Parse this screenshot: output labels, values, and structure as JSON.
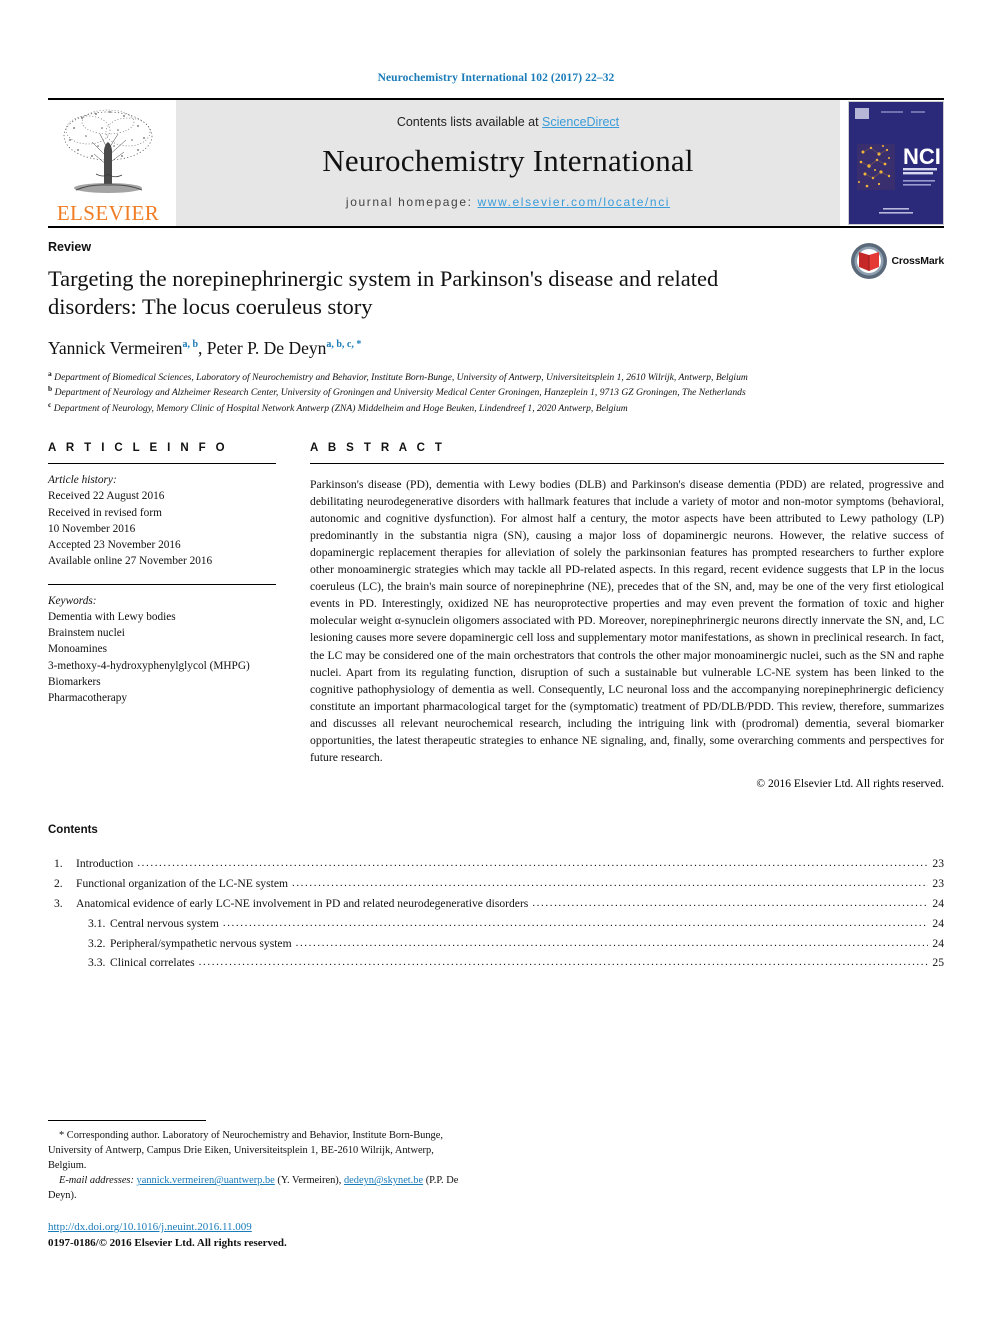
{
  "running_head": "Neurochemistry International 102 (2017) 22–32",
  "masthead": {
    "contents_prefix": "Contents lists available at ",
    "sciencedirect": "ScienceDirect",
    "journal_name": "Neurochemistry International",
    "homepage_prefix": "journal homepage: ",
    "homepage_url": "www.elsevier.com/locate/nci",
    "publisher": "ELSEVIER",
    "cover_title": "NCI",
    "cover_subtitle": "NEUROCHEMISTRY INTERNATIONAL",
    "link_color": "#3b9cd9",
    "elsevier_orange": "#f07c24",
    "cover_bg": "#2b2a7a"
  },
  "article": {
    "type": "Review",
    "title": "Targeting the norepinephrinergic system in Parkinson's disease and related disorders: The locus coeruleus story",
    "authors": [
      {
        "name": "Yannick Vermeiren",
        "marks": "a, b"
      },
      {
        "name": "Peter P. De Deyn",
        "marks": "a, b, c, *"
      }
    ],
    "affiliations": [
      {
        "mark": "a",
        "text": "Department of Biomedical Sciences, Laboratory of Neurochemistry and Behavior, Institute Born-Bunge, University of Antwerp, Universiteitsplein 1, 2610 Wilrijk, Antwerp, Belgium"
      },
      {
        "mark": "b",
        "text": "Department of Neurology and Alzheimer Research Center, University of Groningen and University Medical Center Groningen, Hanzeplein 1, 9713 GZ Groningen, The Netherlands"
      },
      {
        "mark": "c",
        "text": "Department of Neurology, Memory Clinic of Hospital Network Antwerp (ZNA) Middelheim and Hoge Beuken, Lindendreef 1, 2020 Antwerp, Belgium"
      }
    ],
    "crossmark_label": "CrossMark"
  },
  "article_info": {
    "heading": "A R T I C L E   I N F O",
    "history_label": "Article history:",
    "history": [
      "Received 22 August 2016",
      "Received in revised form",
      "10 November 2016",
      "Accepted 23 November 2016",
      "Available online 27 November 2016"
    ],
    "keywords_label": "Keywords:",
    "keywords": [
      "Dementia with Lewy bodies",
      "Brainstem nuclei",
      "Monoamines",
      "3-methoxy-4-hydroxyphenylglycol (MHPG)",
      "Biomarkers",
      "Pharmacotherapy"
    ]
  },
  "abstract": {
    "heading": "A B S T R A C T",
    "body": "Parkinson's disease (PD), dementia with Lewy bodies (DLB) and Parkinson's disease dementia (PDD) are related, progressive and debilitating neurodegenerative disorders with hallmark features that include a variety of motor and non-motor symptoms (behavioral, autonomic and cognitive dysfunction). For almost half a century, the motor aspects have been attributed to Lewy pathology (LP) predominantly in the substantia nigra (SN), causing a major loss of dopaminergic neurons. However, the relative success of dopaminergic replacement therapies for alleviation of solely the parkinsonian features has prompted researchers to further explore other monoaminergic strategies which may tackle all PD-related aspects. In this regard, recent evidence suggests that LP in the locus coeruleus (LC), the brain's main source of norepinephrine (NE), precedes that of the SN, and, may be one of the very first etiological events in PD. Interestingly, oxidized NE has neuroprotective properties and may even prevent the formation of toxic and higher molecular weight α-synuclein oligomers associated with PD. Moreover, norepinephrinergic neurons directly innervate the SN, and, LC lesioning causes more severe dopaminergic cell loss and supplementary motor manifestations, as shown in preclinical research. In fact, the LC may be considered one of the main orchestrators that controls the other major monoaminergic nuclei, such as the SN and raphe nuclei. Apart from its regulating function, disruption of such a sustainable but vulnerable LC-NE system has been linked to the cognitive pathophysiology of dementia as well. Consequently, LC neuronal loss and the accompanying norepinephrinergic deficiency constitute an important pharmacological target for the (symptomatic) treatment of PD/DLB/PDD. This review, therefore, summarizes and discusses all relevant neurochemical research, including the intriguing link with (prodromal) dementia, several biomarker opportunities, the latest therapeutic strategies to enhance NE signaling, and, finally, some overarching comments and perspectives for future research.",
    "copyright": "© 2016 Elsevier Ltd. All rights reserved."
  },
  "contents": {
    "heading": "Contents",
    "entries": [
      {
        "num": "1.",
        "label": "Introduction",
        "page": "23",
        "level": 1
      },
      {
        "num": "2.",
        "label": "Functional organization of the LC-NE system",
        "page": "23",
        "level": 1
      },
      {
        "num": "3.",
        "label": "Anatomical evidence of early LC-NE involvement in PD and related neurodegenerative disorders",
        "page": "24",
        "level": 1
      },
      {
        "num": "3.1.",
        "label": "Central nervous system",
        "page": "24",
        "level": 2
      },
      {
        "num": "3.2.",
        "label": "Peripheral/sympathetic nervous system",
        "page": "24",
        "level": 2
      },
      {
        "num": "3.3.",
        "label": "Clinical correlates",
        "page": "25",
        "level": 2
      }
    ]
  },
  "footnotes": {
    "corresponding": "* Corresponding author. Laboratory of Neurochemistry and Behavior, Institute Born-Bunge, University of Antwerp, Campus Drie Eiken, Universiteitsplein 1, BE-2610 Wilrijk, Antwerp, Belgium.",
    "email_label": "E-mail addresses:",
    "email1": "yannick.vermeiren@uantwerp.be",
    "email1_owner": "(Y. Vermeiren),",
    "email2": "dedeyn@skynet.be",
    "email2_owner": "(P.P. De Deyn).",
    "doi": "http://dx.doi.org/10.1016/j.neuint.2016.11.009",
    "issn": "0197-0186/© 2016 Elsevier Ltd. All rights reserved."
  }
}
